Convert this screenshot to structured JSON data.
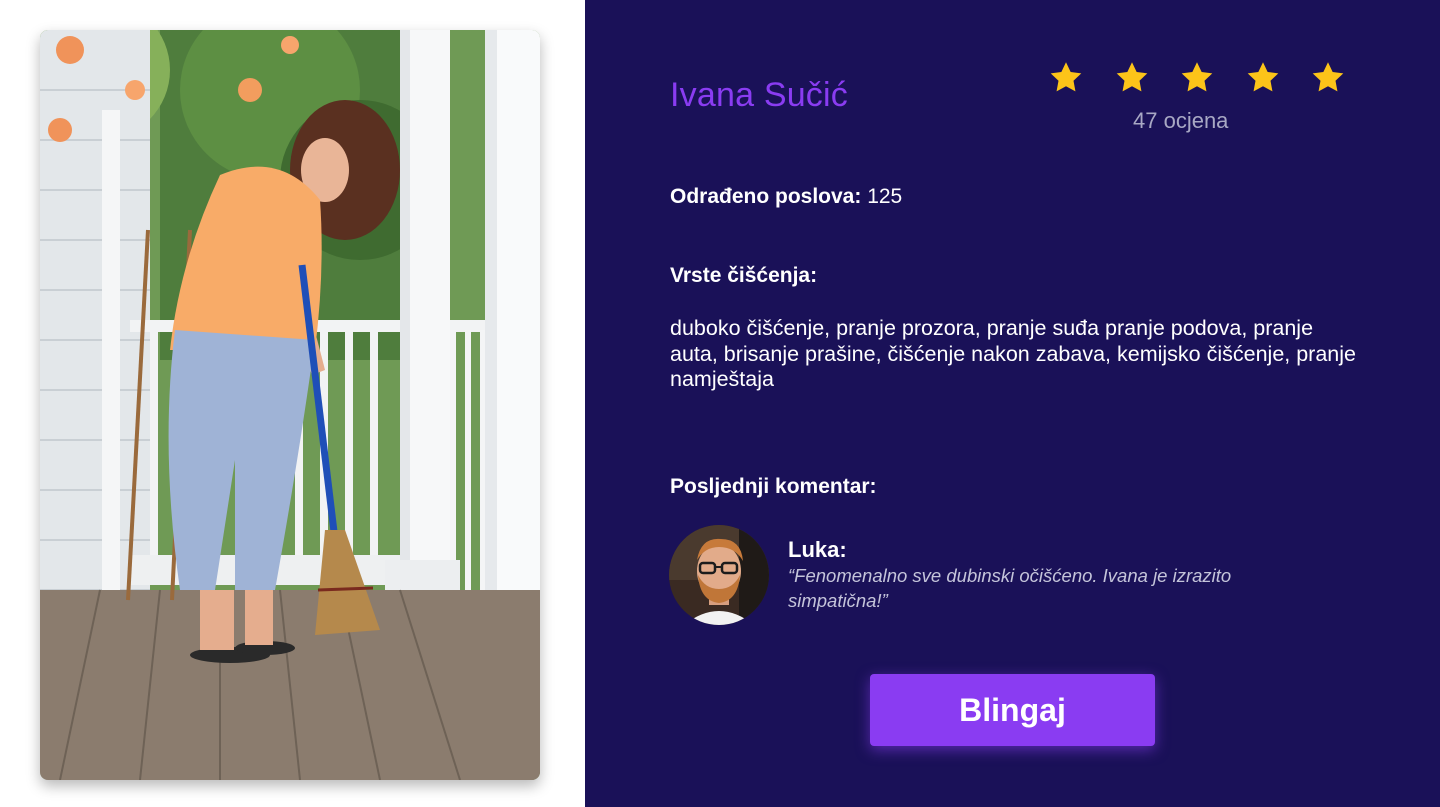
{
  "profile": {
    "name": "Ivana Sučić",
    "rating": {
      "stars": 5,
      "max_stars": 5,
      "count_label": "47 ocjena"
    },
    "jobs_label": "Odrađeno poslova:",
    "jobs_value": "125",
    "types_heading": "Vrste čišćenja:",
    "types_text": "duboko čišćenje, pranje prozora, pranje suđa pranje podova, pranje auta, brisanje prašine, čišćenje nakon zabava, kemijsko čišćenje, pranje namještaja",
    "comment_heading": "Posljednji komentar:",
    "comment": {
      "author": "Luka:",
      "text": "“Fenomenalno sve dubinski očišćeno. Ivana je izrazito simpatična!”"
    },
    "cta_label": "Blingaj"
  },
  "icons": {
    "star": "star-icon"
  },
  "colors": {
    "panel_background": "#1a1158",
    "accent": "#8a3cf2",
    "star": "#fcc419",
    "muted_text": "#a8a8c4"
  }
}
